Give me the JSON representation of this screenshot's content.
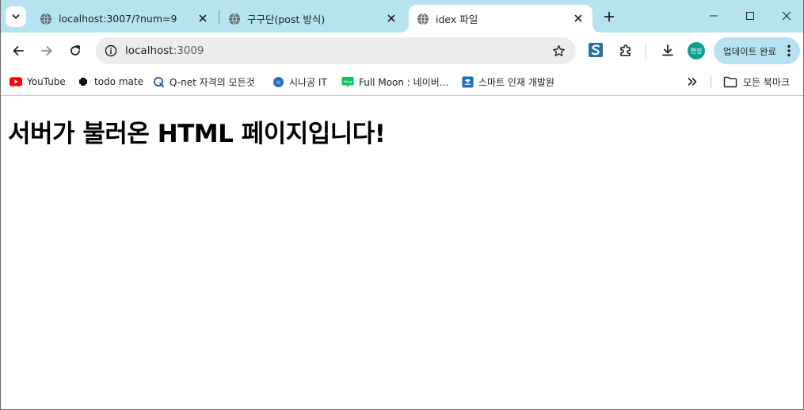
{
  "browser": {
    "tabs": [
      {
        "title": "localhost:3007/?num=9",
        "active": false
      },
      {
        "title": "구구단(post 방식)",
        "active": false
      },
      {
        "title": "idex 파일",
        "active": true
      }
    ],
    "address": {
      "host": "localhost",
      "port": ":3009"
    },
    "profile_label": "현정",
    "update_label": "업데이트 완료",
    "bookmarks": [
      {
        "label": "YouTube",
        "icon": "youtube-icon"
      },
      {
        "label": "todo mate",
        "icon": "todo-mate-icon"
      },
      {
        "label": "Q-net 자격의 모든것",
        "icon": "qnet-icon"
      },
      {
        "label": "시나공 IT",
        "icon": "sinagong-icon"
      },
      {
        "label": "Full Moon : 네이버...",
        "icon": "naver-blog-icon"
      },
      {
        "label": "스마트 인재 개발원",
        "icon": "smart-icon"
      }
    ],
    "all_bookmarks_label": "모든 북마크",
    "colors": {
      "tabstrip": "#b7e3f0",
      "accent": "#0f9d8f"
    }
  },
  "page": {
    "heading": "서버가 불러온 HTML 페이지입니다!"
  }
}
